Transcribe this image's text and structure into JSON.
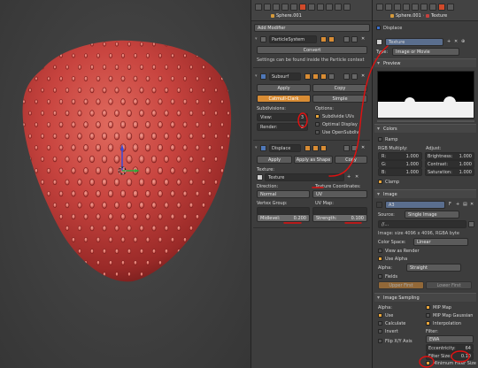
{
  "colors": {
    "accent_orange": "#d88c34",
    "accent_blue": "#5576a0",
    "annotation_red": "#e21010",
    "strawberry": "#c8443f"
  },
  "modifier_panel": {
    "breadcrumb": "Sphere.001",
    "add_modifier": "Add Modifier",
    "particle_system_name": "ParticleSystem",
    "convert_button": "Convert",
    "particle_note": "Settings can be found inside the Particle context",
    "subsurf": {
      "name": "Subsurf",
      "apply": "Apply",
      "copy": "Copy",
      "tab_catmull": "Catmull-Clark",
      "tab_simple": "Simple",
      "subdivisions_label": "Subdivisions:",
      "view_label": "View:",
      "view_value": "3",
      "render_label": "Render:",
      "render_value": "2",
      "options_label": "Options:",
      "subdivide_uvs": "Subdivide UVs",
      "optimal_display": "Optimal Display",
      "use_opensubdiv": "Use OpenSubdiv"
    },
    "displace": {
      "name": "Displace",
      "apply": "Apply",
      "apply_as_shape": "Apply as Shape",
      "copy": "Copy",
      "texture_label": "Texture:",
      "texture_name": "Texture",
      "direction_label": "Direction:",
      "direction_value": "Normal",
      "coordinates_label": "Texture Coordinates:",
      "coordinates_value": "UV",
      "vertex_group_label": "Vertex Group:",
      "uv_map_label": "UV Map:",
      "midlevel_label": "Midlevel:",
      "midlevel_value": "0.200",
      "strength_label": "Strength:",
      "strength_value": "0.100"
    }
  },
  "texture_panel": {
    "breadcrumb_object": "Sphere.001",
    "breadcrumb_texture": "Texture",
    "displace_label": "Displace",
    "texture_name": "Texture",
    "type_label": "Type:",
    "type_value": "Image or Movie",
    "preview_label": "Preview",
    "colors_label": "Colors",
    "ramp_label": "Ramp",
    "rgb_multiply": "RGB Multiply:",
    "adjust": "Adjust:",
    "r_label": "R:",
    "r_value": "1.000",
    "g_label": "G:",
    "g_value": "1.000",
    "b_label": "B:",
    "b_value": "1.000",
    "brightness_label": "Brightness:",
    "brightness_value": "1.000",
    "contrast_label": "Contrast:",
    "contrast_value": "1.000",
    "saturation_label": "Saturation:",
    "saturation_value": "1.000",
    "clamp_label": "Clamp",
    "image_label": "Image",
    "image_name": "A3",
    "source_label": "Source:",
    "source_value": "Single Image",
    "file_path": "//...",
    "image_info": "Image: size 4096 x 4096, RGBA byte",
    "color_space_label": "Color Space:",
    "color_space_value": "Linear",
    "view_as_render": "View as Render",
    "use_alpha": "Use Alpha",
    "alpha_label": "Alpha:",
    "alpha_value": "Straight",
    "fields_label": "Fields",
    "upper_first": "Upper First",
    "lower_first": "Lower First",
    "sampling_label": "Image Sampling",
    "alpha_col": "Alpha:",
    "use": "Use",
    "calc_normal": "Calculate",
    "invert": "Invert",
    "flip_xy": "Flip X/Y Axis",
    "mip_map": "MIP Map",
    "mip_map_gaussian": "MIP Map Gaussian",
    "interpolation": "Interpolation",
    "filter_label": "Filter:",
    "filter_value": "EWA",
    "eccentricity_label": "Eccentricity:",
    "eccentricity_value": "64",
    "filter_size_label": "Filter Size:",
    "filter_size_value": "0.10",
    "minimum_filter": "Minimum Filter Size"
  }
}
